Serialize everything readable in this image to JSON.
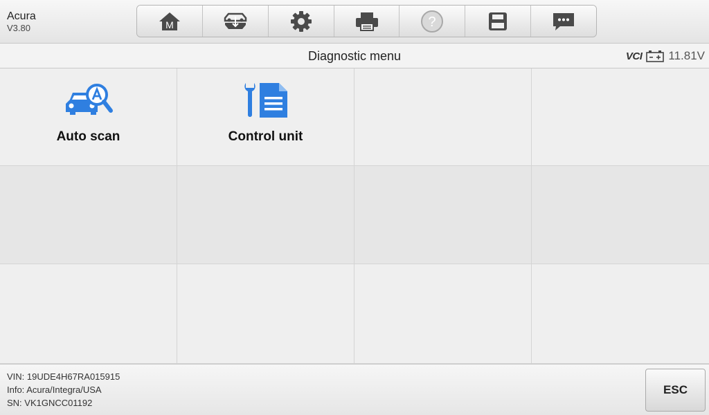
{
  "app": {
    "name": "Acura",
    "version": "V3.80"
  },
  "toolbar": {
    "buttons": [
      {
        "icon": "home-icon",
        "glyph": "M"
      },
      {
        "icon": "vehicle-swap-icon"
      },
      {
        "icon": "gear-icon"
      },
      {
        "icon": "printer-icon"
      },
      {
        "icon": "help-icon",
        "glyph": "?"
      },
      {
        "icon": "save-icon"
      },
      {
        "icon": "message-icon"
      }
    ]
  },
  "title": "Diagnostic menu",
  "status": {
    "vci_text": "VCI",
    "voltage": "11.81V"
  },
  "menu": {
    "items": [
      {
        "label": "Auto scan",
        "icon": "auto-scan-icon"
      },
      {
        "label": "Control unit",
        "icon": "control-unit-icon"
      }
    ]
  },
  "footer": {
    "vin": "VIN: 19UDE4H67RA015915",
    "info": "Info: Acura/Integra/USA",
    "sn": "SN: VK1GNCC01192",
    "esc_label": "ESC"
  },
  "colors": {
    "accent_blue": "#2f7fe0",
    "vci_green": "#1fa640",
    "icon_dark": "#4a4a4a"
  }
}
